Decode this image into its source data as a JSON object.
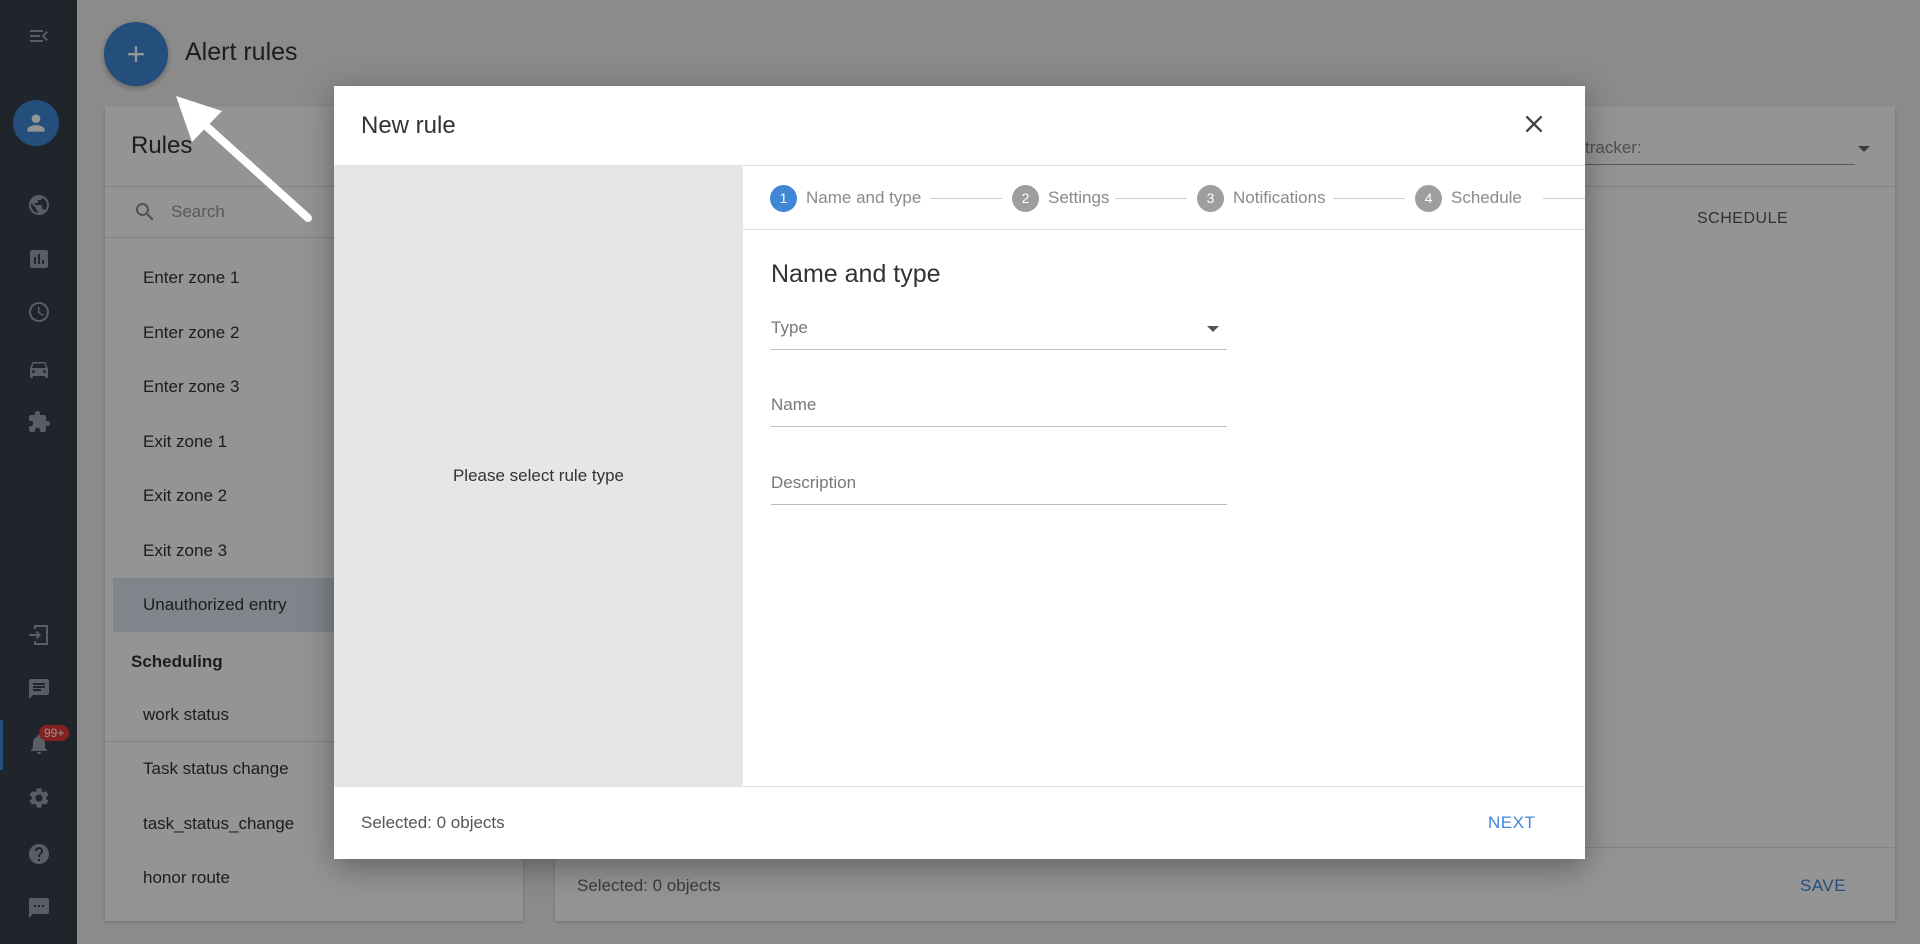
{
  "header": {
    "title": "Alert rules",
    "add_icon": "plus-icon",
    "add_label": "+"
  },
  "sidebar": {
    "icons": [
      "menu-collapse-icon",
      "user-icon",
      "globe-icon",
      "bar-chart-icon",
      "clock-icon",
      "car-icon",
      "puzzle-icon",
      "sign-in-icon",
      "chat-icon",
      "bell-icon",
      "gear-icon",
      "help-icon",
      "message-icon"
    ],
    "notification_badge": "99+",
    "colors": {
      "background": "#37404d",
      "accent": "#3f87d6",
      "badge": "#e53935"
    }
  },
  "rules_panel": {
    "title": "Rules",
    "search_placeholder": "Search",
    "items": [
      {
        "label": "Enter zone 1"
      },
      {
        "label": "Enter zone 2"
      },
      {
        "label": "Enter zone 3"
      },
      {
        "label": "Exit zone 1"
      },
      {
        "label": "Exit zone 2"
      },
      {
        "label": "Exit zone 3"
      },
      {
        "label": "Unauthorized entry",
        "selected": true
      }
    ],
    "section_title": "Scheduling",
    "section_items": [
      {
        "label": "work status"
      },
      {
        "label": "Task status change"
      },
      {
        "label": "task_status_change"
      },
      {
        "label": "honor route"
      }
    ]
  },
  "right_panel": {
    "tracker_label": "tracker:",
    "schedule_column": "SCHEDULE",
    "selected_text": "Selected: 0 objects",
    "save_label": "SAVE"
  },
  "modal": {
    "title": "New rule",
    "left_message": "Please select rule type",
    "steps": [
      {
        "num": "1",
        "label": "Name and type",
        "active": true
      },
      {
        "num": "2",
        "label": "Settings"
      },
      {
        "num": "3",
        "label": "Notifications"
      },
      {
        "num": "4",
        "label": "Schedule"
      }
    ],
    "form_heading": "Name and type",
    "fields": {
      "type_placeholder": "Type",
      "name_placeholder": "Name",
      "description_placeholder": "Description"
    },
    "footer": {
      "selected_text": "Selected: 0 objects",
      "next_label": "NEXT"
    }
  }
}
